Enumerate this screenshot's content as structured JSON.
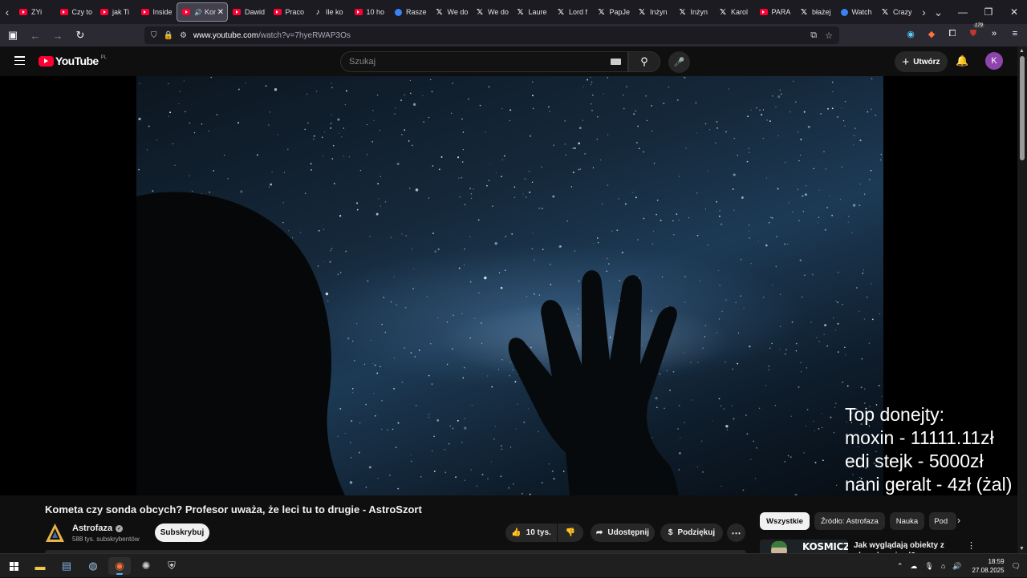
{
  "browser": {
    "tabs": [
      {
        "label": "ZYi",
        "icon": "youtube"
      },
      {
        "label": "Czy to",
        "icon": "youtube"
      },
      {
        "label": "jak Ti",
        "icon": "youtube"
      },
      {
        "label": "Inside",
        "icon": "youtube"
      },
      {
        "label": "Kor",
        "icon": "youtube",
        "active": true
      },
      {
        "label": "Dawid",
        "icon": "youtube"
      },
      {
        "label": "Praco",
        "icon": "youtube"
      },
      {
        "label": "Ile ko",
        "icon": "tiktok"
      },
      {
        "label": "10 ho",
        "icon": "youtube"
      },
      {
        "label": "Rasze",
        "icon": "blue"
      },
      {
        "label": "We do",
        "icon": "x"
      },
      {
        "label": "We do",
        "icon": "x"
      },
      {
        "label": "Laure",
        "icon": "x"
      },
      {
        "label": "Lord f",
        "icon": "x"
      },
      {
        "label": "PapJe",
        "icon": "x"
      },
      {
        "label": "Inżyn",
        "icon": "x"
      },
      {
        "label": "Inżyn",
        "icon": "x"
      },
      {
        "label": "Karol",
        "icon": "x"
      },
      {
        "label": "PARA",
        "icon": "youtube"
      },
      {
        "label": "błażej",
        "icon": "x"
      },
      {
        "label": "Watch",
        "icon": "blue"
      },
      {
        "label": "Crazy",
        "icon": "x"
      }
    ],
    "url_host": "www.youtube.com",
    "url_path": "/watch?v=7hyeRWAP3Os",
    "extension_badge": "179"
  },
  "youtube": {
    "logo_text": "YouTube",
    "country_code": "PL",
    "search_placeholder": "Szukaj",
    "create_label": "Utwórz",
    "avatar_letter": "K"
  },
  "video": {
    "overlay_lines": [
      "Top donejty:",
      "moxin - 11111.11zł",
      "edi stejk - 5000zł",
      "nani geralt - 4zł (żal)"
    ],
    "title": "Kometa czy sonda obcych? Profesor uważa, że leci tu to drugie - AstroSzort",
    "channel_name": "Astrofaza",
    "subscribers": "588 tys. subskrybentów",
    "subscribe_label": "Subskrybuj",
    "likes": "10 tys.",
    "share_label": "Udostępnij",
    "thanks_label": "Podziękuj"
  },
  "sidebar": {
    "chips": [
      "Wszystkie",
      "Źródło: Astrofaza",
      "Nauka",
      "Pod"
    ],
    "recommendation": {
      "thumb_text": "KOSMICZNI",
      "title": "Jak wyglądają obiekty z obcych gwiazd?"
    }
  },
  "taskbar": {
    "time": "18:59",
    "date": "27.08.2025"
  },
  "colors": {
    "yt_red": "#ff0033",
    "page_bg": "#0f0f0f",
    "chip_bg": "#272727",
    "avatar_purple": "#8e44ad"
  }
}
